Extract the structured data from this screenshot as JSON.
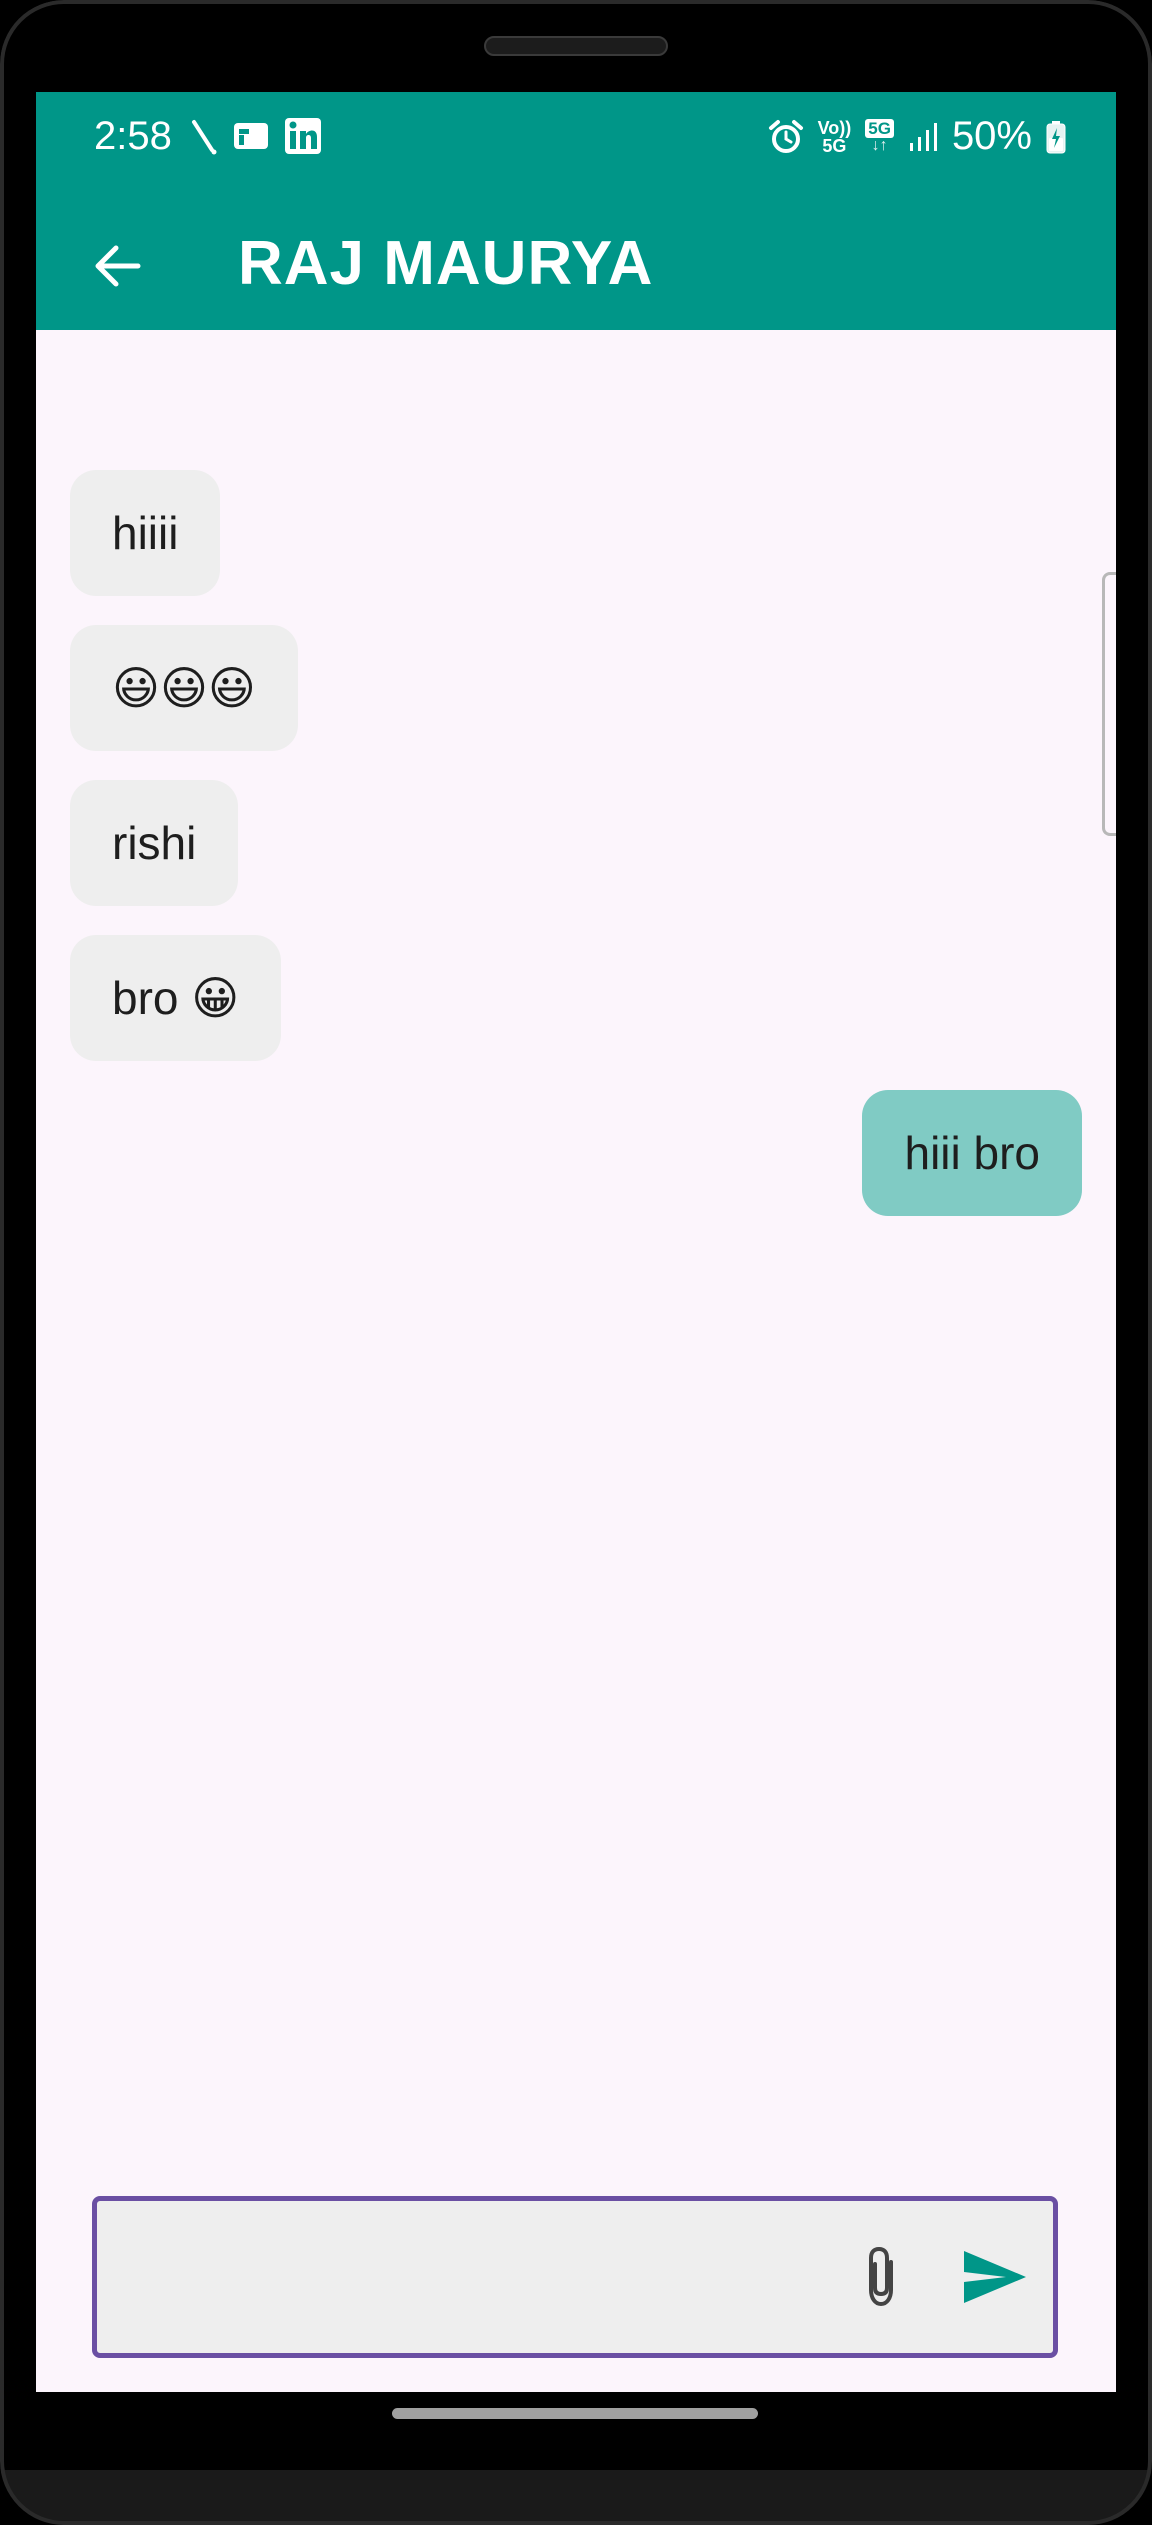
{
  "status_bar": {
    "time": "2:58",
    "battery_percent": "50%",
    "network_label_top": "Vo))",
    "network_label_bottom": "5G",
    "data_badge": "5G"
  },
  "header": {
    "title": "RAJ MAURYA",
    "accent_color": "#009688"
  },
  "messages": [
    {
      "direction": "incoming",
      "text": "hiiii"
    },
    {
      "direction": "incoming",
      "text": "😃😃😃"
    },
    {
      "direction": "incoming",
      "text": "rishi"
    },
    {
      "direction": "incoming",
      "text": "bro 😀"
    },
    {
      "direction": "outgoing",
      "text": "hiii bro"
    }
  ],
  "composer": {
    "value": "",
    "placeholder": "",
    "border_color": "#6a4fa3",
    "attach_icon": "paperclip-icon",
    "send_icon": "send-icon"
  }
}
